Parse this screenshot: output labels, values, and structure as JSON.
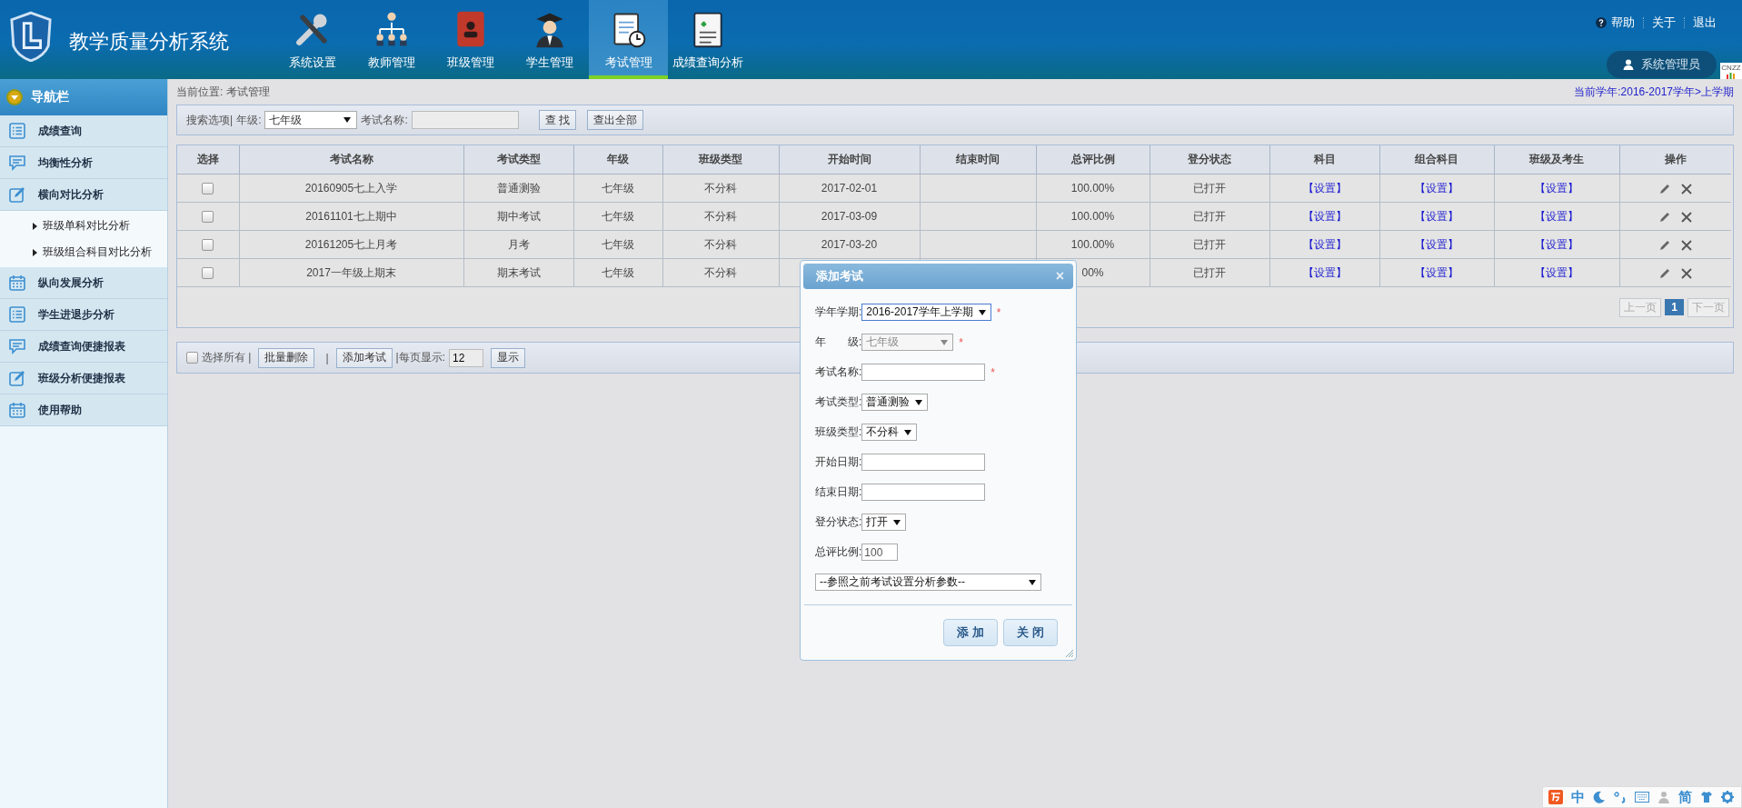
{
  "header": {
    "title": "教学质量分析系统",
    "nav": [
      {
        "label": "系统设置",
        "selected": false
      },
      {
        "label": "教师管理",
        "selected": false
      },
      {
        "label": "班级管理",
        "selected": false
      },
      {
        "label": "学生管理",
        "selected": false
      },
      {
        "label": "考试管理",
        "selected": true
      },
      {
        "label": "成绩查询分析",
        "selected": false
      }
    ],
    "links": [
      "帮助",
      "关于",
      "退出"
    ],
    "user": "系统管理员",
    "badge": "CNZZ"
  },
  "sidebar": {
    "title": "导航栏",
    "items": [
      {
        "label": "成绩查询"
      },
      {
        "label": "均衡性分析"
      },
      {
        "label": "横向对比分析",
        "expanded": true,
        "children": [
          {
            "label": "班级单科对比分析"
          },
          {
            "label": "班级组合科目对比分析"
          }
        ]
      },
      {
        "label": "纵向发展分析"
      },
      {
        "label": "学生进退步分析"
      },
      {
        "label": "成绩查询便捷报表"
      },
      {
        "label": "班级分析便捷报表"
      },
      {
        "label": "使用帮助"
      }
    ]
  },
  "breadcrumb": "当前位置: 考试管理",
  "term": "当前学年:2016-2017学年>上学期",
  "search": {
    "label": "搜索选项|",
    "grade_label": "年级:",
    "grade": "七年级",
    "name_label": "考试名称:",
    "buttons": [
      "查 找",
      "查出全部"
    ]
  },
  "table": {
    "columns": [
      "选择",
      "考试名称",
      "考试类型",
      "年级",
      "班级类型",
      "开始时间",
      "结束时间",
      "总评比例",
      "登分状态",
      "科目",
      "组合科目",
      "班级及考生",
      "操作"
    ],
    "rows": [
      {
        "checked": false,
        "cells": [
          "",
          "20160905七上入学",
          "普通测验",
          "七年级",
          "不分科",
          "2017-02-01",
          "",
          "100.00%",
          "已打开",
          "【设置】",
          "【设置】",
          "【设置】",
          ""
        ]
      },
      {
        "checked": false,
        "cells": [
          "",
          "20161101七上期中",
          "期中考试",
          "七年级",
          "不分科",
          "2017-03-09",
          "",
          "100.00%",
          "已打开",
          "【设置】",
          "【设置】",
          "【设置】",
          ""
        ]
      },
      {
        "checked": false,
        "cells": [
          "",
          "20161205七上月考",
          "月考",
          "七年级",
          "不分科",
          "2017-03-20",
          "",
          "100.00%",
          "已打开",
          "【设置】",
          "【设置】",
          "【设置】",
          ""
        ]
      },
      {
        "checked": false,
        "cells": [
          "",
          "2017一年级上期末",
          "期末考试",
          "七年级",
          "不分科",
          "",
          "",
          "00%",
          "已打开",
          "【设置】",
          "【设置】",
          "【设置】",
          ""
        ]
      }
    ]
  },
  "pagination": {
    "prev": "上一页",
    "pages": [
      {
        "label": "1",
        "selected": true
      }
    ],
    "next": "下一页"
  },
  "toolbar": {
    "select_all": {
      "label": "选择所有 |",
      "checked": false
    },
    "sep": "|",
    "batch_delete": "批量删除",
    "add": "添加考试",
    "per_page_label": "|每页显示:",
    "per_page": "12",
    "show": "显示"
  },
  "dialog": {
    "title": "添加考试",
    "close": "×",
    "fields": [
      {
        "kind": "select",
        "label": "学年学期:",
        "value": "2016-2017学年上学期",
        "mark": "*",
        "focused": true
      },
      {
        "kind": "select",
        "label": "年　　级:",
        "value": "七年级",
        "mark": "*",
        "disabled": true
      },
      {
        "kind": "input",
        "label": "考试名称:",
        "mark": "*"
      },
      {
        "kind": "select",
        "label": "考试类型:",
        "value": "普通测验"
      },
      {
        "kind": "select",
        "label": "班级类型:",
        "value": "不分科"
      },
      {
        "kind": "input",
        "label": "开始日期:"
      },
      {
        "kind": "input",
        "label": "结束日期:"
      },
      {
        "kind": "select",
        "label": "登分状态:",
        "value": "打开"
      },
      {
        "kind": "input",
        "label": "总评比例:",
        "value": "100"
      },
      {
        "kind": "wide-select",
        "value": "--参照之前考试设置分析参数--"
      }
    ],
    "buttons": [
      "添 加",
      "关 闭"
    ]
  },
  "ime": {
    "mode": "中",
    "script": "简"
  }
}
